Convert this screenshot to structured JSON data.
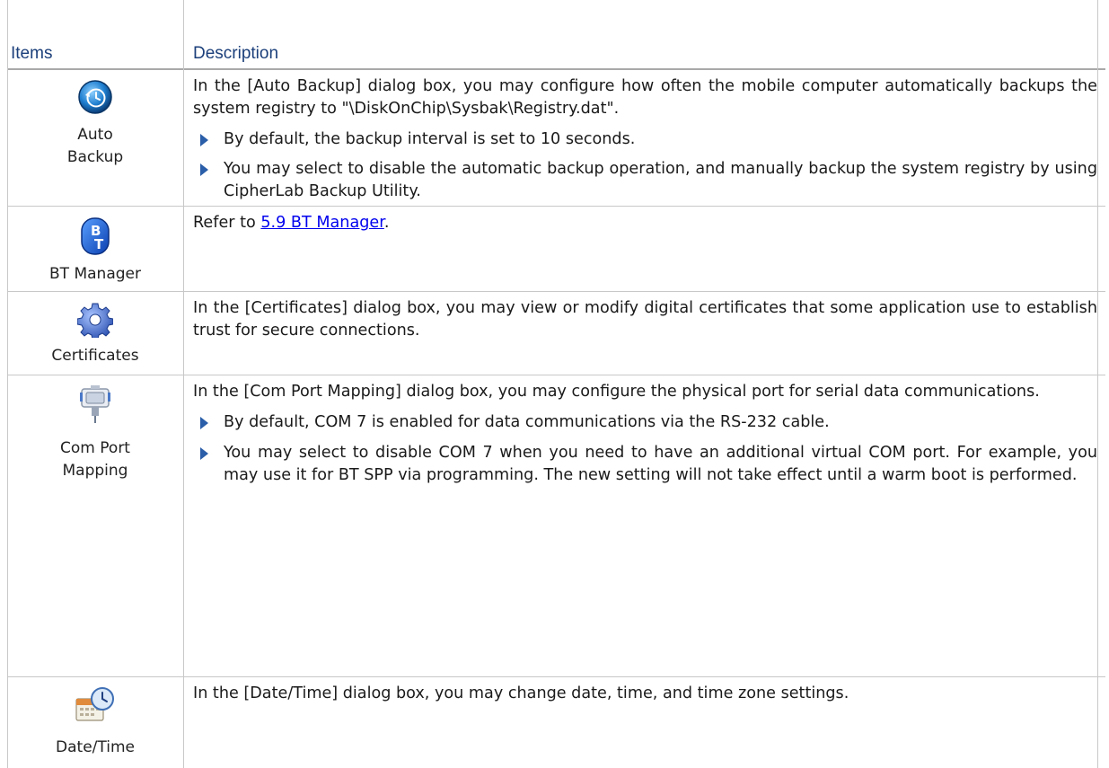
{
  "table": {
    "headers": {
      "items": "Items",
      "description": "Description"
    },
    "rows": [
      {
        "icon": "auto-backup-icon",
        "label_lines": [
          "Auto",
          "Backup"
        ],
        "paragraph": "In the [Auto Backup] dialog box, you may configure how often the mobile computer automatically backups the system registry to \"\\DiskOnChip\\Sysbak\\Registry.dat\".",
        "bullets": [
          "By default, the backup interval is set to 10 seconds.",
          "You may select to disable the automatic backup operation, and manually backup the system registry by using CipherLab Backup Utility."
        ]
      },
      {
        "icon": "bt-manager-icon",
        "label_lines": [
          "BT Manager"
        ],
        "paragraph_prefix": "Refer to ",
        "link_text": "5.9 BT Manager",
        "paragraph_suffix": "."
      },
      {
        "icon": "certificates-icon",
        "label_lines": [
          "Certificates"
        ],
        "paragraph": "In the [Certificates] dialog box, you may view or modify digital certificates that some application use to establish trust for secure connections."
      },
      {
        "icon": "com-port-mapping-icon",
        "label_lines": [
          "Com Port",
          "Mapping"
        ],
        "paragraph": "In the [Com Port Mapping] dialog box, you may configure the physical port for serial data communications.",
        "bullets": [
          "By default, COM 7 is enabled for data communications via the RS-232 cable.",
          "You may select to disable COM 7 when you need to have an additional virtual COM port. For example, you may use it for BT SPP via programming. The new setting will not take effect until a warm boot is performed."
        ]
      },
      {
        "icon": "date-time-icon",
        "label_lines": [
          "Date/Time"
        ],
        "paragraph": "In the [Date/Time] dialog box, you may change date, time, and time zone settings."
      }
    ]
  },
  "colors": {
    "header_text": "#1b3f7a",
    "bullet": "#2a5ea8",
    "link": "#0000ee"
  }
}
